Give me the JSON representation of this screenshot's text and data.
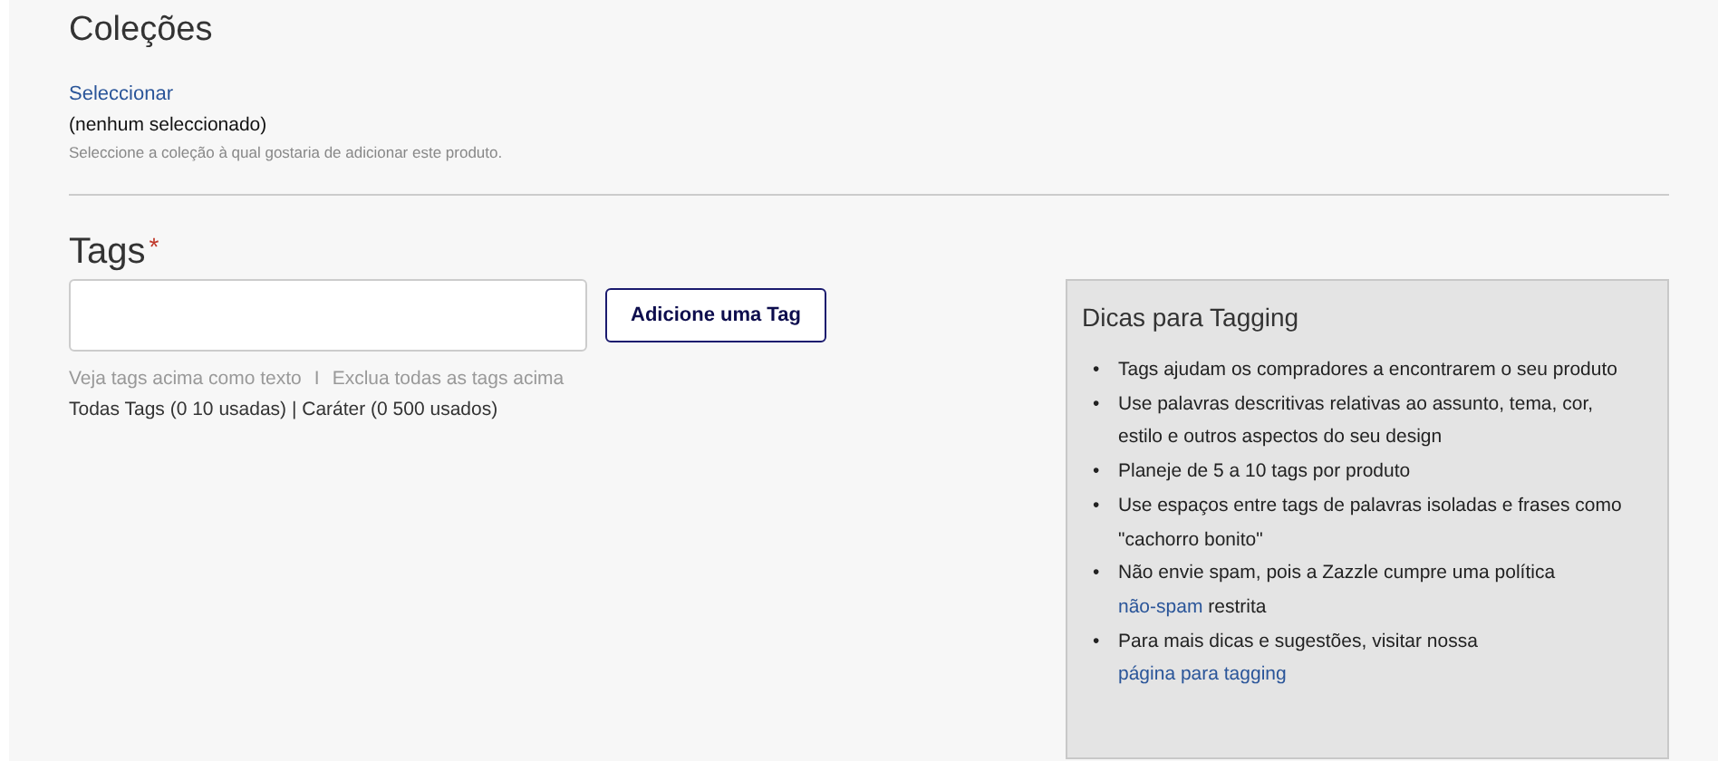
{
  "collections": {
    "title": "Coleções",
    "select_link": "Seleccionar",
    "selection": "(nenhum seleccionado)",
    "hint": "Seleccione a coleção à qual gostaria de adicionar este produto."
  },
  "tags": {
    "title": "Tags",
    "required": true,
    "required_mark": "*",
    "add_button": "Adicione uma Tag",
    "links": [
      "Veja tags acima como texto",
      "Exclua todas as tags acima"
    ],
    "separator": "I",
    "usage": "Todas Tags (0 10 usadas) | Caráter (0 500 usados)"
  },
  "tips": {
    "title": "Dicas para Tagging",
    "bullet": "•",
    "items": [
      {
        "text": "Tags ajudam os compradores a encontrarem o seu produto"
      },
      {
        "text": "Use palavras descritivas relativas ao assunto, tema, cor, estilo e outros aspectos do seu design"
      },
      {
        "text": "Planeje de 5 a 10 tags por produto"
      },
      {
        "text": "Use espaços entre tags de palavras isoladas e frases como \"cachorro bonito\""
      },
      {
        "text": "Não envie spam, pois a Zazzle cumpre uma política ",
        "link": "não-spam",
        "after": " restrita"
      },
      {
        "text": "Para mais dicas e sugestões, visitar nossa ",
        "link": "página para tagging"
      }
    ]
  }
}
